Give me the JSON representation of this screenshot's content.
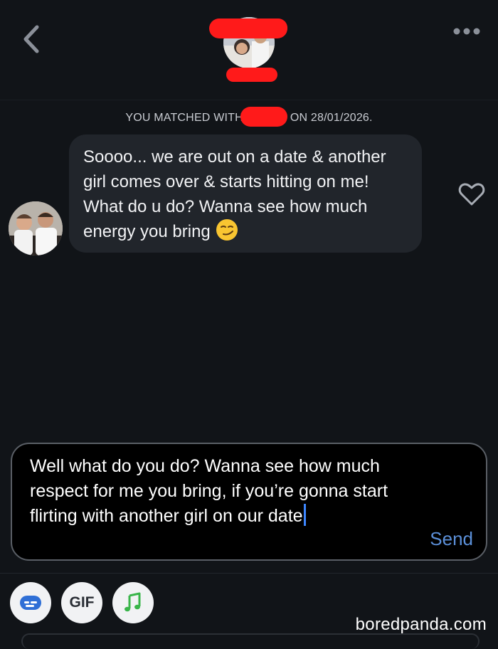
{
  "header": {
    "back_icon": "chevron-left-icon",
    "more_icon": "ellipsis-icon",
    "redaction_color": "#ff1a1a"
  },
  "conversation": {
    "match_note_prefix": "YOU MATCHED WITH",
    "match_note_suffix": "ON 28/01/2026.",
    "messages": [
      {
        "from": "match",
        "text": "Soooo... we are out on a date & another girl comes over & starts hitting on me! What do u do? Wanna see how much energy you bring",
        "emoji": "smirking-face-icon",
        "like_icon": "heart-outline-icon"
      }
    ]
  },
  "composer": {
    "draft": "Well what do you do? Wanna see how much respect for me you bring, if you’re gonna start flirting with another girl on our date",
    "send_label": "Send",
    "send_color": "#5b8fd8",
    "caret_color": "#3d86ff"
  },
  "toolbar": {
    "items": [
      {
        "icon": "card-icon"
      },
      {
        "label": "GIF"
      },
      {
        "icon": "music-note-icon"
      }
    ]
  },
  "watermark": "boredpanda.com",
  "colors": {
    "background": "#111418",
    "bubble": "#21252b",
    "composer_border": "#5a5f66"
  }
}
